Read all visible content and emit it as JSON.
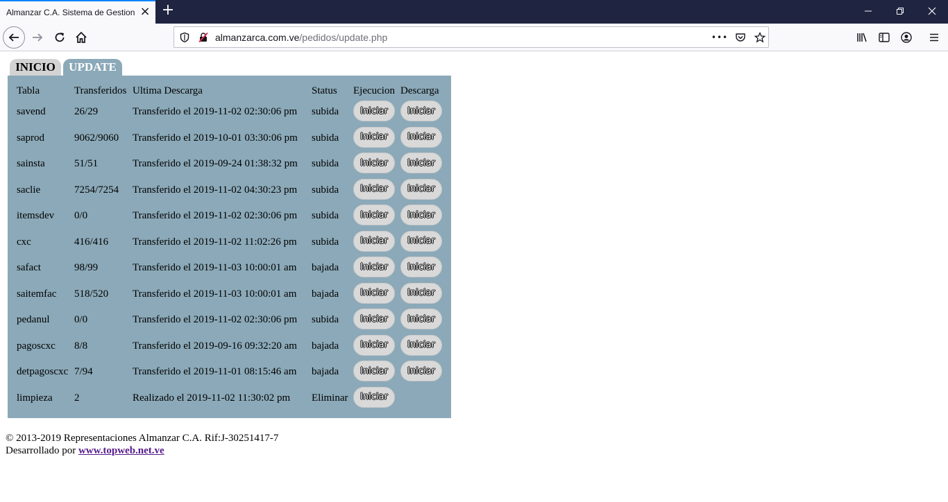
{
  "browser": {
    "tab_title": "Almanzar C.A. Sistema de Gestion de Pedidos",
    "url_domain": "almanzarca.com.ve",
    "url_path": "/pedidos/update.php",
    "url_more": "•••"
  },
  "page": {
    "tabs": [
      {
        "label": "INICIO"
      },
      {
        "label": "UPDATE"
      }
    ],
    "table": {
      "headers": [
        "Tabla",
        "Transferidos",
        "Ultima Descarga",
        "Status",
        "Ejecucion",
        "Descarga"
      ],
      "button_label": "Iniciar",
      "rows": [
        {
          "tabla": "savend",
          "transferidos": "26/29",
          "ultima": "Transferido el 2019-11-02 02:30:06 pm",
          "status": "subida"
        },
        {
          "tabla": "saprod",
          "transferidos": "9062/9060",
          "ultima": "Transferido el 2019-10-01 03:30:06 pm",
          "status": "subida"
        },
        {
          "tabla": "sainsta",
          "transferidos": "51/51",
          "ultima": "Transferido el 2019-09-24 01:38:32 pm",
          "status": "subida"
        },
        {
          "tabla": "saclie",
          "transferidos": "7254/7254",
          "ultima": "Transferido el 2019-11-02 04:30:23 pm",
          "status": "subida"
        },
        {
          "tabla": "itemsdev",
          "transferidos": "0/0",
          "ultima": "Transferido el 2019-11-02 02:30:06 pm",
          "status": "subida"
        },
        {
          "tabla": "cxc",
          "transferidos": "416/416",
          "ultima": "Transferido el 2019-11-02 11:02:26 pm",
          "status": "subida"
        },
        {
          "tabla": "safact",
          "transferidos": "98/99",
          "ultima": "Transferido el 2019-11-03 10:00:01 am",
          "status": "bajada"
        },
        {
          "tabla": "saitemfac",
          "transferidos": "518/520",
          "ultima": "Transferido el 2019-11-03 10:00:01 am",
          "status": "bajada"
        },
        {
          "tabla": "pedanul",
          "transferidos": "0/0",
          "ultima": "Transferido el 2019-11-02 02:30:06 pm",
          "status": "subida"
        },
        {
          "tabla": "pagoscxc",
          "transferidos": "8/8",
          "ultima": "Transferido el 2019-09-16 09:32:20 am",
          "status": "bajada"
        },
        {
          "tabla": "detpagoscxc",
          "transferidos": "7/94",
          "ultima": "Transferido el 2019-11-01 08:15:46 am",
          "status": "bajada"
        },
        {
          "tabla": "limpieza",
          "transferidos": "2",
          "ultima": "Realizado el 2019-11-02 11:30:02 pm",
          "status": "Eliminar"
        }
      ]
    },
    "footer": {
      "copyright": "© 2013-2019 Representaciones Almanzar C.A. Rif:J-30251417-7",
      "dev_prefix": "Desarrollado por",
      "dev_link": "www.topweb.net.ve"
    }
  }
}
